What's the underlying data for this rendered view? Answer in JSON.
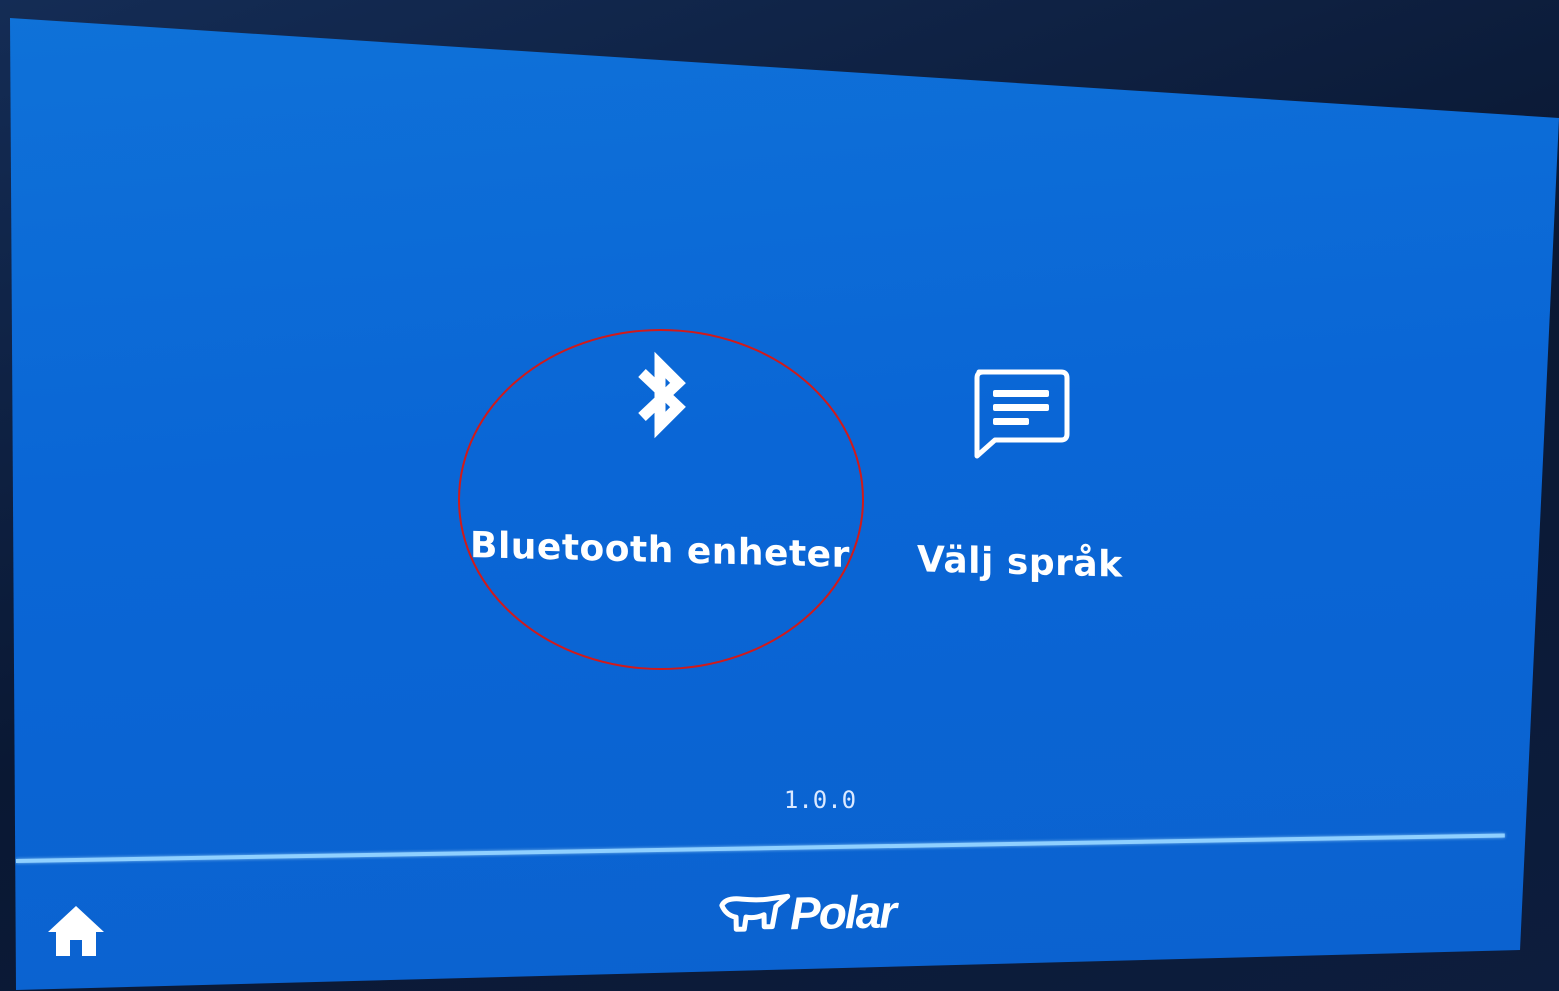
{
  "menu": {
    "items": [
      {
        "label": "Bluetooth enheter",
        "icon": "bluetooth-icon",
        "highlighted": true
      },
      {
        "label": "Välj språk",
        "icon": "message-icon",
        "highlighted": false
      }
    ]
  },
  "footer": {
    "version": "1.0.0",
    "brand": "Polar",
    "home_icon": "home-icon"
  },
  "colors": {
    "screen_background": "#0a66d6",
    "text": "#ffffff",
    "divider": "#8fd0ff",
    "highlight": "#d11a1a"
  }
}
